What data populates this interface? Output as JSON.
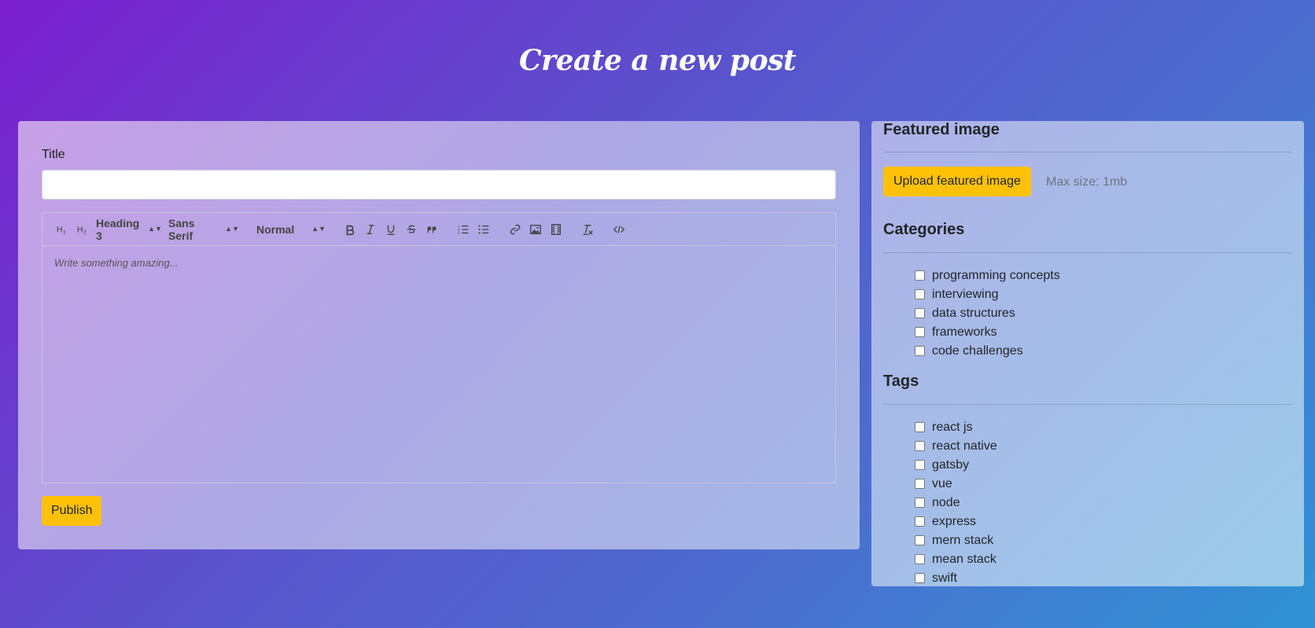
{
  "page": {
    "title": "Create a new post"
  },
  "editor": {
    "title_label": "Title",
    "title_value": "",
    "toolbar": {
      "h1": "H1",
      "h2": "H2",
      "heading_select": "Heading 3",
      "font_select": "Sans Serif",
      "size_select": "Normal"
    },
    "placeholder": "Write something amazing...",
    "publish_label": "Publish"
  },
  "sidebar": {
    "featured": {
      "heading": "Featured image",
      "upload_label": "Upload featured image",
      "max_size": "Max size: 1mb"
    },
    "categories": {
      "heading": "Categories",
      "items": [
        "programming concepts",
        "interviewing",
        "data structures",
        "frameworks",
        "code challenges"
      ]
    },
    "tags": {
      "heading": "Tags",
      "items": [
        "react js",
        "react native",
        "gatsby",
        "vue",
        "node",
        "express",
        "mern stack",
        "mean stack",
        "swift"
      ]
    }
  },
  "colors": {
    "accent": "#ffc107",
    "gradient_start": "#7b1fcf",
    "gradient_end": "#2f93d4"
  }
}
